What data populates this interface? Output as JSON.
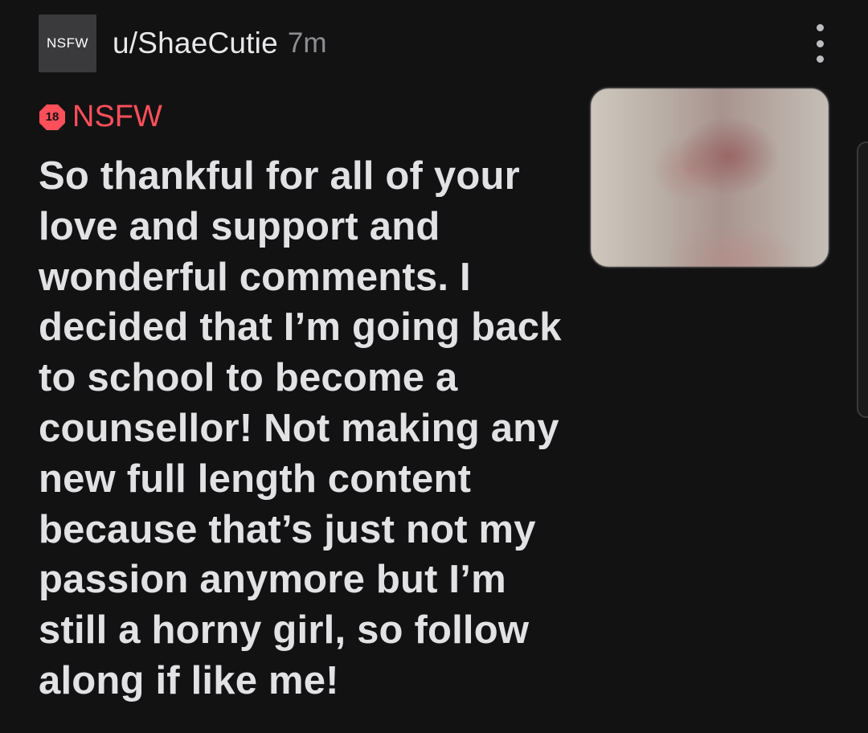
{
  "post": {
    "avatar_text": "NSFW",
    "username": "u/ShaeCutie",
    "timestamp": "7m",
    "nsfw_badge_number": "18",
    "nsfw_label": "NSFW",
    "title": "So thankful for all of your love and support and wonderful comments. I decided that I’m going back to school to become a counsellor! Not making any new full length content because that’s just not my passion anymore but I’m still a horny girl, so follow along if like me!"
  },
  "icons": {
    "more_menu": "more-vertical-icon",
    "nsfw_badge": "nsfw-18-icon"
  },
  "colors": {
    "background": "#121213",
    "nsfw_accent": "#ff4f5a",
    "title_text": "#e2e2e4",
    "meta_text": "#8e8e92"
  }
}
